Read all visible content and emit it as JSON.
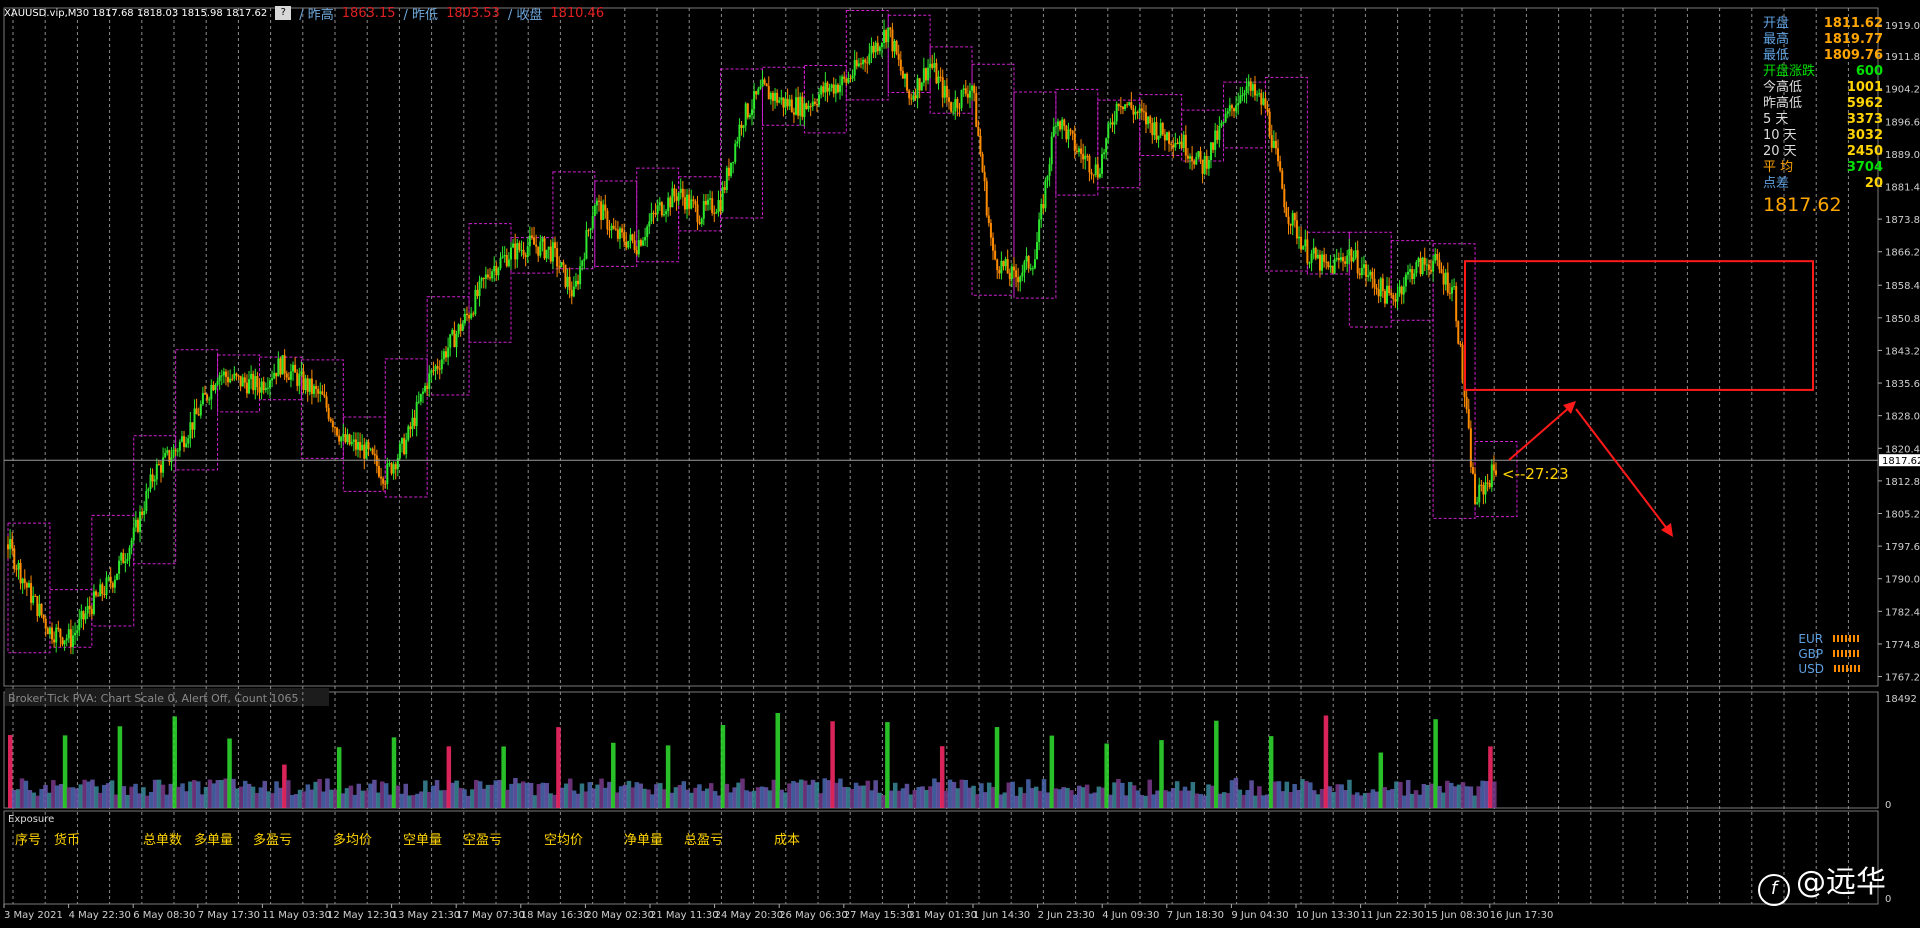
{
  "header": {
    "symbol_line": "XAUUSD.vip,M30  1817.68 1818.03 1815.98 1817.62",
    "button": "?",
    "prev_high_label": "/ 昨高",
    "prev_high_value": "1863.15",
    "prev_low_label": "/ 昨低",
    "prev_low_value": "1803.53",
    "close_label": "/ 收盘",
    "close_value": "1810.46"
  },
  "stats": [
    {
      "label": "开盘",
      "value": "1811.62",
      "label_color": "#5fa0e0",
      "value_color": "#ffa500"
    },
    {
      "label": "最高",
      "value": "1819.77",
      "label_color": "#5fa0e0",
      "value_color": "#ffa500"
    },
    {
      "label": "最低",
      "value": "1809.76",
      "label_color": "#5fa0e0",
      "value_color": "#ffa500"
    },
    {
      "label": "开盘涨跌",
      "value": "600",
      "label_color": "#00e000",
      "value_color": "#00e000"
    },
    {
      "label": "今高低",
      "value": "1001",
      "label_color": "#dddddd",
      "value_color": "#ffd400"
    },
    {
      "label": "昨高低",
      "value": "5962",
      "label_color": "#dddddd",
      "value_color": "#ffd400"
    },
    {
      "label": "5  天",
      "value": "3373",
      "label_color": "#dddddd",
      "value_color": "#ffd400"
    },
    {
      "label": "10 天",
      "value": "3032",
      "label_color": "#dddddd",
      "value_color": "#ffd400"
    },
    {
      "label": "20 天",
      "value": "2450",
      "label_color": "#dddddd",
      "value_color": "#ffd400"
    },
    {
      "label": "平  均",
      "value": "3704",
      "label_color": "#ffa500",
      "value_color": "#00e000"
    },
    {
      "label": "点差",
      "value": "20",
      "label_color": "#5fa0e0",
      "value_color": "#ffd400"
    }
  ],
  "big_price": "1817.62",
  "currency": [
    {
      "code": "EUR"
    },
    {
      "code": "GBP"
    },
    {
      "code": "USD"
    }
  ],
  "countdown": "<--27:23",
  "indicator_title": "Broker Tick  PVA:   Chart Scale  0,  Alert Off,  Count  1065",
  "exposure": {
    "title": "Exposure",
    "headers": [
      {
        "text": "序号",
        "x": 15
      },
      {
        "text": "货币",
        "x": 54
      },
      {
        "text": "总单数",
        "x": 143
      },
      {
        "text": "多单量",
        "x": 194
      },
      {
        "text": "多盈亏",
        "x": 253
      },
      {
        "text": "多均价",
        "x": 333
      },
      {
        "text": "空单量",
        "x": 403
      },
      {
        "text": "空盈亏",
        "x": 463
      },
      {
        "text": "空均价",
        "x": 544
      },
      {
        "text": "净单量",
        "x": 624
      },
      {
        "text": "总盈亏",
        "x": 684
      },
      {
        "text": "成本",
        "x": 774
      }
    ]
  },
  "watermark": "@远华",
  "chart_data": {
    "type": "candlestick",
    "symbol": "XAUUSD.vip",
    "timeframe": "M30",
    "y_ticks": [
      "1919.04",
      "1911.80",
      "1904.20",
      "1896.60",
      "1889.00",
      "1881.40",
      "1873.80",
      "1866.20",
      "1858.40",
      "1850.80",
      "1843.20",
      "1835.60",
      "1828.00",
      "1820.40",
      "1812.80",
      "1805.20",
      "1797.60",
      "1790.00",
      "1782.40",
      "1774.80",
      "1767.20"
    ],
    "ylim": [
      1765.0,
      1923.0
    ],
    "current_price": "1817.62",
    "x_labels": [
      "3 May 2021",
      "4 May 22:30",
      "6 May 08:30",
      "7 May 17:30",
      "11 May 03:30",
      "12 May 12:30",
      "13 May 21:30",
      "17 May 07:30",
      "18 May 16:30",
      "20 May 02:30",
      "21 May 11:30",
      "24 May 20:30",
      "26 May 06:30",
      "27 May 15:30",
      "31 May 01:30",
      "1 Jun 14:30",
      "2 Jun 23:30",
      "4 Jun 09:30",
      "7 Jun 18:30",
      "9 Jun 04:30",
      "10 Jun 13:30",
      "11 Jun 22:30",
      "15 Jun 08:30",
      "16 Jun 17:30"
    ],
    "price_path": [
      1798,
      1787,
      1778,
      1776,
      1784,
      1790,
      1800,
      1815,
      1820,
      1828,
      1838,
      1836,
      1835,
      1840,
      1836,
      1832,
      1822,
      1820,
      1814,
      1822,
      1836,
      1844,
      1852,
      1862,
      1866,
      1868,
      1866,
      1856,
      1878,
      1870,
      1868,
      1876,
      1880,
      1875,
      1878,
      1897,
      1904,
      1901,
      1900,
      1904,
      1906,
      1912,
      1918,
      1902,
      1910,
      1900,
      1905,
      1865,
      1860,
      1865,
      1898,
      1890,
      1885,
      1902,
      1898,
      1894,
      1892,
      1886,
      1896,
      1905,
      1900,
      1876,
      1866,
      1862,
      1866,
      1860,
      1855,
      1862,
      1864,
      1857,
      1808,
      1816
    ],
    "volume_ymax": "18492",
    "volume_ymin": "0",
    "annotation_box_price": [
      1864.0,
      1834.0
    ]
  }
}
